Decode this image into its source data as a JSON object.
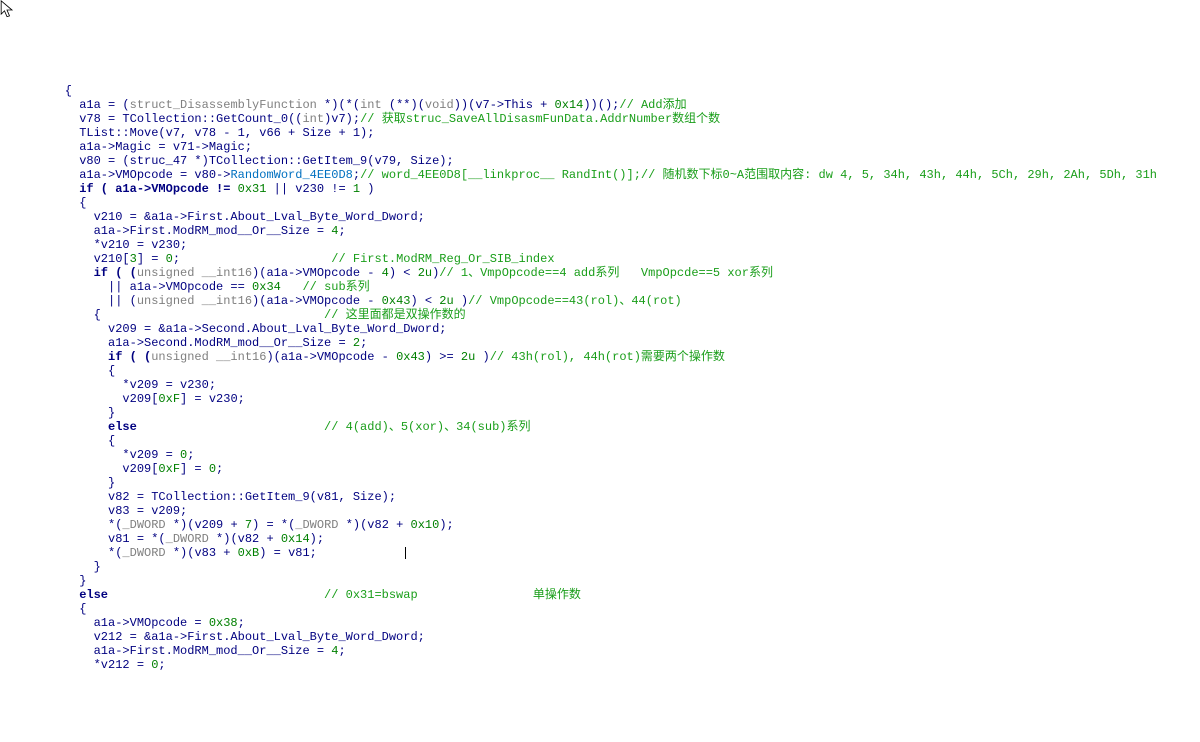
{
  "lines": {
    "l1": "    {",
    "l2a": "      a1a = (",
    "l2b": "struct_DisassemblyFunction",
    "l2c": " *)(*(",
    "l2d": "int",
    "l2e": " (**)(",
    "l2f": "void",
    "l2g": "))(v7",
    "l2h": "->This + ",
    "l2i": "0x14",
    "l2j": "))();",
    "l2k": "// Add添加",
    "l3a": "      v78 = ",
    "l3b": "TCollection::GetCount_0",
    "l3c": "((",
    "l3d": "int",
    "l3e": ")v7);",
    "l3f": "// 获取struc_SaveAllDisasmFunData.AddrNumber数组个数",
    "l4": "      TList::Move(v7, v78 - 1, v66 + Size + 1);",
    "l5": "      a1a->Magic = v71->Magic;",
    "l6": "      v80 = (struc_47 *)TCollection::GetItem_9(v79, Size);",
    "l7a": "      a1a->VMOpcode = v80->",
    "l7b": "RandomWord_4EE0D8",
    "l7c": ";",
    "l7d": "// word_4EE0D8[__linkproc__ RandInt()];// 随机数下标0~A范围取内容: dw 4, 5, 34h, 43h, 44h, 5Ch, 29h, 2Ah, 5Dh, 31h",
    "l8a": "      if ( a1a->VMOpcode != ",
    "l8b": "0x31",
    "l8c": " || v230 != ",
    "l8d": "1",
    "l8e": " )",
    "l9": "      {",
    "l10": "        v210 = &a1a->First.About_Lval_Byte_Word_Dword;",
    "l11a": "        a1a->First.ModRM_mod__Or__Size = ",
    "l11b": "4",
    "l11c": ";",
    "l12": "        *v210 = v230;",
    "l13a": "        v210[",
    "l13b": "3",
    "l13c": "] = ",
    "l13d": "0",
    "l13e": ";                     ",
    "l13f": "// First.ModRM_Reg_Or_SIB_index",
    "l14a": "        if ( (",
    "l14b": "unsigned __int16",
    "l14c": ")(a1a->VMOpcode - ",
    "l14d": "4",
    "l14e": ") < ",
    "l14f": "2u",
    "l14g": ")",
    "l14h": "// 1、VmpOpcode==4 add系列   VmpOpcde==5 xor系列",
    "l15a": "          || a1a->VMOpcode == ",
    "l15b": "0x34",
    "l15c": "   ",
    "l15d": "// sub系列",
    "l16a": "          || (",
    "l16b": "unsigned __int16",
    "l16c": ")(a1a->VMOpcode - ",
    "l16d": "0x43",
    "l16e": ") < ",
    "l16f": "2u",
    "l16g": " )",
    "l16h": "// VmpOpcode==43(rol)、44(rot)",
    "l17a": "        {                               ",
    "l17b": "// 这里面都是双操作数的",
    "l18": "          v209 = &a1a->Second.About_Lval_Byte_Word_Dword;",
    "l19a": "          a1a->Second.ModRM_mod__Or__Size = ",
    "l19b": "2",
    "l19c": ";",
    "l20a": "          if ( (",
    "l20b": "unsigned __int16",
    "l20c": ")(a1a->VMOpcode - ",
    "l20d": "0x43",
    "l20e": ") >= ",
    "l20f": "2u",
    "l20g": " )",
    "l20h": "// 43h(rol), 44h(rot)需要两个操作数",
    "l21": "          {",
    "l22": "            *v209 = v230;",
    "l23a": "            v209[",
    "l23b": "0xF",
    "l23c": "] = v230;",
    "l24": "          }",
    "l25a": "          else                          ",
    "l25b": "// 4(add)、5(xor)、34(sub)系列",
    "l26": "          {",
    "l27a": "            *v209 = ",
    "l27b": "0",
    "l27c": ";",
    "l28a": "            v209[",
    "l28b": "0xF",
    "l28c": "] = ",
    "l28d": "0",
    "l28e": ";",
    "l29": "          }",
    "l30": "          v82 = TCollection::GetItem_9(v81, Size);",
    "l31": "          v83 = v209;",
    "l32a": "          *(",
    "l32b": "_DWORD",
    "l32c": " *)(v209 + ",
    "l32d": "7",
    "l32e": ") = *(",
    "l32f": "_DWORD",
    "l32g": " *)(v82 + ",
    "l32h": "0x10",
    "l32i": ");",
    "l33a": "          v81 = *(",
    "l33b": "_DWORD",
    "l33c": " *)(v82 + ",
    "l33d": "0x14",
    "l33e": ");",
    "l34a": "          *(",
    "l34b": "_DWORD",
    "l34c": " *)(v83 + ",
    "l34d": "0xB",
    "l34e": ") = v81;            ",
    "l35": "        }",
    "l36": "      }",
    "l37a": "      else                              ",
    "l37b": "// 0x31=bswap                单操作数",
    "l38": "      {",
    "l39a": "        a1a->VMOpcode = ",
    "l39b": "0x38",
    "l39c": ";",
    "l40": "        v212 = &a1a->First.About_Lval_Byte_Word_Dword;",
    "l41a": "        a1a->First.ModRM_mod__Or__Size = ",
    "l41b": "4",
    "l41c": ";",
    "l42a": "        *v212 = ",
    "l42b": "0",
    "l42c": ";"
  }
}
